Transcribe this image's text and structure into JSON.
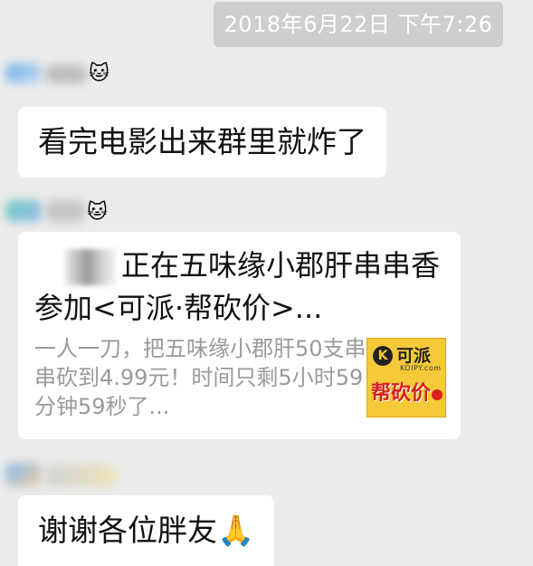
{
  "timestamp": "2018年6月22日 下午7:26",
  "messages": [
    {
      "text": "看完电影出来群里就炸了"
    },
    {
      "text": "谢谢各位胖友🙏"
    }
  ],
  "share_card": {
    "title": "正在五味缘小郡肝串串香参加<可派·帮砍价>...",
    "description": "一人一刀，把五味缘小郡肝50支串串砍到4.99元！时间只剩5小时59分钟59秒了...",
    "thumbnail": {
      "logo_icon": "K",
      "brand": "可派",
      "brand_sub": "KOIPY.com",
      "promo": "帮砍价"
    }
  },
  "colors": {
    "background": "#ebebeb",
    "bubble": "#ffffff",
    "timestamp_bg": "#cecece",
    "thumbnail_bg": "#f4c93a",
    "promo_red": "#d81e1e"
  }
}
